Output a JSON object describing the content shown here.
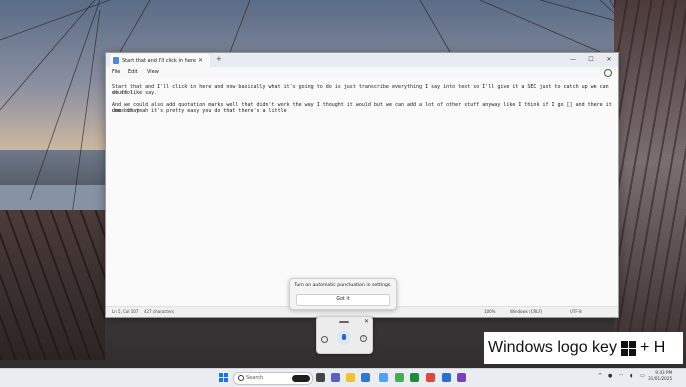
{
  "notepad": {
    "tab_title": "Start that and I'll click in here a",
    "menu": [
      "File",
      "Edit",
      "View"
    ],
    "lines": [
      "Start that and I'll click in here and now basically what it's going to do is just transcribe everything I say into text so I'll give it a SEC just to catch up we can do cool",
      "stuff like say.",
      "",
      "And we could also add quotation marks well that didn't work the way I thought it would but we can add a lot of other stuff anyway like I think if I go [] and there it does that",
      "umm but yeah it's pretty easy you do that there's a little"
    ],
    "status": {
      "position": "Ln 5, Col 107",
      "characters": "427 characters",
      "zoom": "100%",
      "line_ending": "Windows (CRLF)",
      "encoding": "UTF-8"
    }
  },
  "punctuation_popup": {
    "message": "Turn on automatic punctuation in settings.",
    "button": "Got it"
  },
  "caption": {
    "text": "Windows logo key",
    "suffix": "+ H"
  },
  "taskbar": {
    "search_placeholder": "Search",
    "time": "9:43 PM",
    "date": "31/01/2025"
  },
  "colors": {
    "accent": "#1a73e8",
    "mic_blue": "#2563c8"
  }
}
